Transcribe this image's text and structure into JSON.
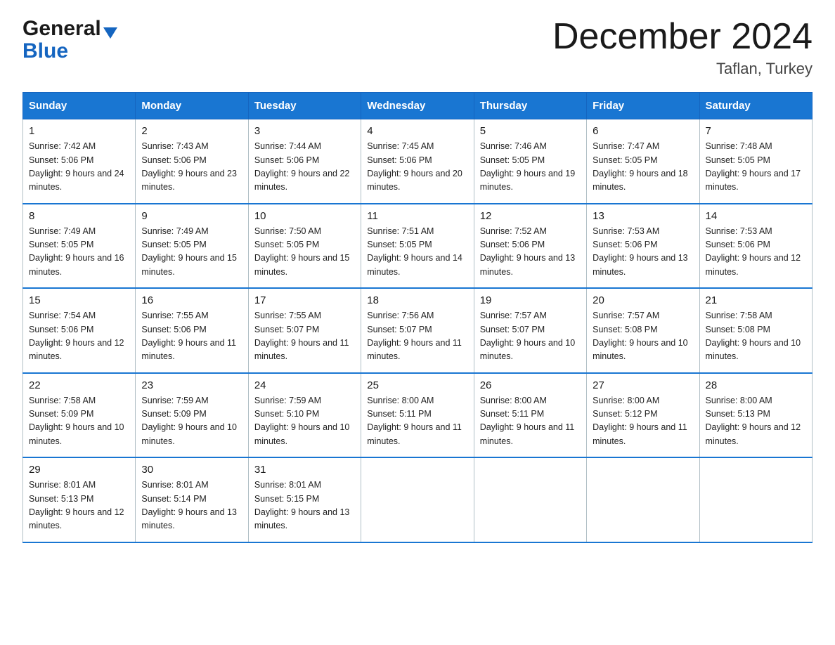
{
  "header": {
    "logo_general": "General",
    "logo_blue": "Blue",
    "month_title": "December 2024",
    "location": "Taflan, Turkey"
  },
  "weekdays": [
    "Sunday",
    "Monday",
    "Tuesday",
    "Wednesday",
    "Thursday",
    "Friday",
    "Saturday"
  ],
  "weeks": [
    [
      {
        "day": "1",
        "sunrise": "7:42 AM",
        "sunset": "5:06 PM",
        "daylight": "9 hours and 24 minutes."
      },
      {
        "day": "2",
        "sunrise": "7:43 AM",
        "sunset": "5:06 PM",
        "daylight": "9 hours and 23 minutes."
      },
      {
        "day": "3",
        "sunrise": "7:44 AM",
        "sunset": "5:06 PM",
        "daylight": "9 hours and 22 minutes."
      },
      {
        "day": "4",
        "sunrise": "7:45 AM",
        "sunset": "5:06 PM",
        "daylight": "9 hours and 20 minutes."
      },
      {
        "day": "5",
        "sunrise": "7:46 AM",
        "sunset": "5:05 PM",
        "daylight": "9 hours and 19 minutes."
      },
      {
        "day": "6",
        "sunrise": "7:47 AM",
        "sunset": "5:05 PM",
        "daylight": "9 hours and 18 minutes."
      },
      {
        "day": "7",
        "sunrise": "7:48 AM",
        "sunset": "5:05 PM",
        "daylight": "9 hours and 17 minutes."
      }
    ],
    [
      {
        "day": "8",
        "sunrise": "7:49 AM",
        "sunset": "5:05 PM",
        "daylight": "9 hours and 16 minutes."
      },
      {
        "day": "9",
        "sunrise": "7:49 AM",
        "sunset": "5:05 PM",
        "daylight": "9 hours and 15 minutes."
      },
      {
        "day": "10",
        "sunrise": "7:50 AM",
        "sunset": "5:05 PM",
        "daylight": "9 hours and 15 minutes."
      },
      {
        "day": "11",
        "sunrise": "7:51 AM",
        "sunset": "5:05 PM",
        "daylight": "9 hours and 14 minutes."
      },
      {
        "day": "12",
        "sunrise": "7:52 AM",
        "sunset": "5:06 PM",
        "daylight": "9 hours and 13 minutes."
      },
      {
        "day": "13",
        "sunrise": "7:53 AM",
        "sunset": "5:06 PM",
        "daylight": "9 hours and 13 minutes."
      },
      {
        "day": "14",
        "sunrise": "7:53 AM",
        "sunset": "5:06 PM",
        "daylight": "9 hours and 12 minutes."
      }
    ],
    [
      {
        "day": "15",
        "sunrise": "7:54 AM",
        "sunset": "5:06 PM",
        "daylight": "9 hours and 12 minutes."
      },
      {
        "day": "16",
        "sunrise": "7:55 AM",
        "sunset": "5:06 PM",
        "daylight": "9 hours and 11 minutes."
      },
      {
        "day": "17",
        "sunrise": "7:55 AM",
        "sunset": "5:07 PM",
        "daylight": "9 hours and 11 minutes."
      },
      {
        "day": "18",
        "sunrise": "7:56 AM",
        "sunset": "5:07 PM",
        "daylight": "9 hours and 11 minutes."
      },
      {
        "day": "19",
        "sunrise": "7:57 AM",
        "sunset": "5:07 PM",
        "daylight": "9 hours and 10 minutes."
      },
      {
        "day": "20",
        "sunrise": "7:57 AM",
        "sunset": "5:08 PM",
        "daylight": "9 hours and 10 minutes."
      },
      {
        "day": "21",
        "sunrise": "7:58 AM",
        "sunset": "5:08 PM",
        "daylight": "9 hours and 10 minutes."
      }
    ],
    [
      {
        "day": "22",
        "sunrise": "7:58 AM",
        "sunset": "5:09 PM",
        "daylight": "9 hours and 10 minutes."
      },
      {
        "day": "23",
        "sunrise": "7:59 AM",
        "sunset": "5:09 PM",
        "daylight": "9 hours and 10 minutes."
      },
      {
        "day": "24",
        "sunrise": "7:59 AM",
        "sunset": "5:10 PM",
        "daylight": "9 hours and 10 minutes."
      },
      {
        "day": "25",
        "sunrise": "8:00 AM",
        "sunset": "5:11 PM",
        "daylight": "9 hours and 11 minutes."
      },
      {
        "day": "26",
        "sunrise": "8:00 AM",
        "sunset": "5:11 PM",
        "daylight": "9 hours and 11 minutes."
      },
      {
        "day": "27",
        "sunrise": "8:00 AM",
        "sunset": "5:12 PM",
        "daylight": "9 hours and 11 minutes."
      },
      {
        "day": "28",
        "sunrise": "8:00 AM",
        "sunset": "5:13 PM",
        "daylight": "9 hours and 12 minutes."
      }
    ],
    [
      {
        "day": "29",
        "sunrise": "8:01 AM",
        "sunset": "5:13 PM",
        "daylight": "9 hours and 12 minutes."
      },
      {
        "day": "30",
        "sunrise": "8:01 AM",
        "sunset": "5:14 PM",
        "daylight": "9 hours and 13 minutes."
      },
      {
        "day": "31",
        "sunrise": "8:01 AM",
        "sunset": "5:15 PM",
        "daylight": "9 hours and 13 minutes."
      },
      null,
      null,
      null,
      null
    ]
  ]
}
